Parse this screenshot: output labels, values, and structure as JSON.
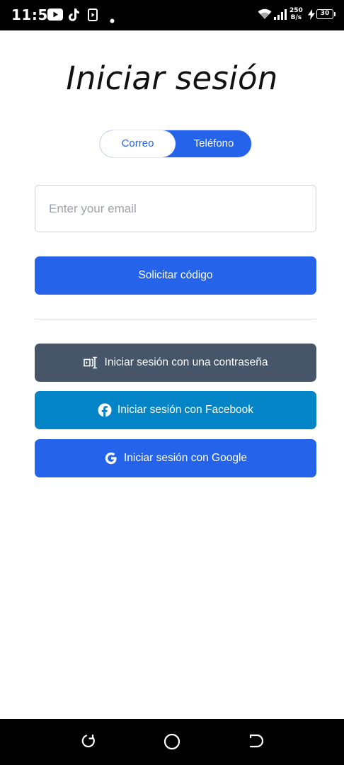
{
  "status_bar": {
    "time": "11:50",
    "net_speed_value": "250",
    "net_speed_unit": "B/s",
    "battery": "30"
  },
  "page": {
    "title": "Iniciar sesión"
  },
  "login_mode": {
    "options": [
      "Correo",
      "Teléfono"
    ],
    "selected": "Teléfono"
  },
  "email": {
    "placeholder": "Enter your email",
    "value": ""
  },
  "actions": {
    "request_code": "Solicitar código",
    "password_login": "Iniciar sesión con una contraseña",
    "facebook_login": "Iniciar sesión con Facebook",
    "google_login": "Iniciar sesión con Google"
  },
  "colors": {
    "primary": "#2563eb",
    "password_button": "#475569",
    "facebook_button": "#0284c7"
  }
}
